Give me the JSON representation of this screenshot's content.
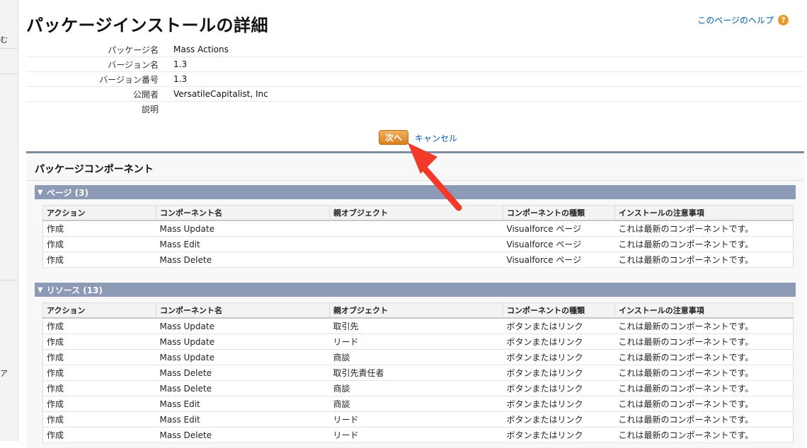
{
  "left_strip": {
    "frag1": "む",
    "frag2": "ア"
  },
  "page_title": "パッケージインストールの詳細",
  "help": {
    "label": "このページのヘルプ",
    "icon": "help-icon"
  },
  "info": [
    {
      "label": "パッケージ名",
      "value": "Mass Actions"
    },
    {
      "label": "バージョン名",
      "value": "1.3"
    },
    {
      "label": "バージョン番号",
      "value": "1.3"
    },
    {
      "label": "公開者",
      "value": "VersatileCapitalist, Inc"
    },
    {
      "label": "説明",
      "value": ""
    }
  ],
  "buttons": {
    "next": "次へ",
    "cancel": "キャンセル"
  },
  "components": {
    "title": "パッケージコンポーネント",
    "columns": [
      "アクション",
      "コンポーネント名",
      "親オブジェクト",
      "コンポーネントの種類",
      "インストールの注意事項"
    ],
    "pages": {
      "label": "ページ (3)",
      "rows": [
        [
          "作成",
          "Mass Update",
          "",
          "Visualforce ページ",
          "これは最新のコンポーネントです。"
        ],
        [
          "作成",
          "Mass Edit",
          "",
          "Visualforce ページ",
          "これは最新のコンポーネントです。"
        ],
        [
          "作成",
          "Mass Delete",
          "",
          "Visualforce ページ",
          "これは最新のコンポーネントです。"
        ]
      ]
    },
    "resources": {
      "label": "リソース (13)",
      "rows": [
        [
          "作成",
          "Mass Update",
          "取引先",
          "ボタンまたはリンク",
          "これは最新のコンポーネントです。"
        ],
        [
          "作成",
          "Mass Update",
          "リード",
          "ボタンまたはリンク",
          "これは最新のコンポーネントです。"
        ],
        [
          "作成",
          "Mass Update",
          "商談",
          "ボタンまたはリンク",
          "これは最新のコンポーネントです。"
        ],
        [
          "作成",
          "Mass Delete",
          "取引先責任者",
          "ボタンまたはリンク",
          "これは最新のコンポーネントです。"
        ],
        [
          "作成",
          "Mass Delete",
          "商談",
          "ボタンまたはリンク",
          "これは最新のコンポーネントです。"
        ],
        [
          "作成",
          "Mass Edit",
          "商談",
          "ボタンまたはリンク",
          "これは最新のコンポーネントです。"
        ],
        [
          "作成",
          "Mass Edit",
          "リード",
          "ボタンまたはリンク",
          "これは最新のコンポーネントです。"
        ],
        [
          "作成",
          "Mass Delete",
          "リード",
          "ボタンまたはリンク",
          "これは最新のコンポーネントです。"
        ]
      ]
    }
  },
  "colors": {
    "accent_orange": "#e0902e",
    "section_bar": "#8d9ab5",
    "link_blue": "#015ba7",
    "arrow_red": "#f23a2a"
  }
}
